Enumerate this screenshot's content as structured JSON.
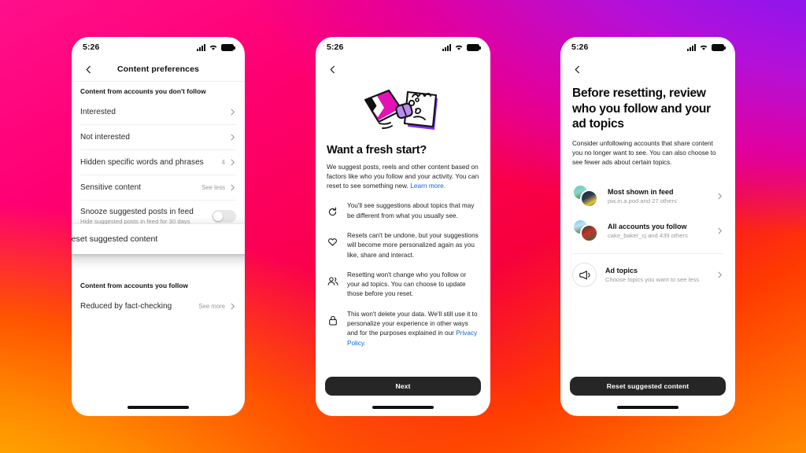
{
  "background": {
    "gradient_colors": [
      "#6f2bff",
      "#b410d8",
      "#ff0f8c",
      "#f7003c",
      "#ff8a00",
      "#ffd200"
    ]
  },
  "theme": {
    "accent_link": "#0a66e0",
    "button_bg": "#262626",
    "text_primary": "#262626",
    "text_muted": "#9a9a9a"
  },
  "status_bar": {
    "time": "5:26",
    "signal_icon": "cellular-signal-icon",
    "wifi_icon": "wifi-icon",
    "battery_icon": "battery-icon"
  },
  "phone1": {
    "nav": {
      "back_icon": "chevron-left-icon",
      "title": "Content preferences"
    },
    "section1_header": "Content from accounts you don't follow",
    "rows": [
      {
        "label": "Interested",
        "value": "",
        "chevron": true
      },
      {
        "label": "Not interested",
        "value": "",
        "chevron": true
      },
      {
        "label": "Hidden specific words and phrases",
        "value": "4",
        "chevron": true
      },
      {
        "label": "Sensitive content",
        "value": "See less",
        "chevron": true
      }
    ],
    "snooze": {
      "label": "Snooze suggested posts in feed",
      "sub": "Hide suggested posts in feed for 30 days",
      "toggle_state": "off"
    },
    "highlight": {
      "label": "Reset suggested content",
      "chevron": true
    },
    "section2_header": "Content from accounts you follow",
    "row_fact": {
      "label": "Reduced by fact-checking",
      "value": "See more",
      "chevron": true
    }
  },
  "phone2": {
    "nav": {
      "back_icon": "chevron-left-icon"
    },
    "illustration": "pencil-erasing-notepad-illustration",
    "title": "Want a fresh start?",
    "paragraph_before_link": "We suggest posts, reels and other content based on factors like who you follow and your activity. You can reset to see something new. ",
    "paragraph_link": "Learn more.",
    "bullets": [
      {
        "icon": "refresh-icon",
        "text": "You'll see suggestions about topics that may be different from what you usually see."
      },
      {
        "icon": "heart-icon",
        "text": "Resets can't be undone, but your suggestions will become more personalized again as you like, share and interact."
      },
      {
        "icon": "people-icon",
        "text": "Resetting won't change who you follow or your ad topics. You can choose to update those before you reset."
      },
      {
        "icon": "lock-icon",
        "text": "This won't delete your data. We'll still use it to personalize your experience in other ways and for the purposes explained in our ",
        "link": "Privacy Policy."
      }
    ],
    "cta": "Next"
  },
  "phone3": {
    "nav": {
      "back_icon": "chevron-left-icon"
    },
    "title": "Before resetting, review who you follow and your ad topics",
    "paragraph": "Consider unfollowing accounts that share content you no longer want to see. You can also choose to see fewer ads about certain topics.",
    "items": [
      {
        "icon": "avatar-stack",
        "title": "Most shown in feed",
        "sub": "pia.in.a.pod and 27 others",
        "chevron": true
      },
      {
        "icon": "avatar-stack",
        "title": "All accounts you follow",
        "sub": "cake_baker_cj and 439 others",
        "chevron": true
      },
      {
        "icon": "megaphone-icon",
        "title": "Ad topics",
        "sub": "Choose topics you want to see less",
        "chevron": true
      }
    ],
    "cta": "Reset suggested content"
  }
}
